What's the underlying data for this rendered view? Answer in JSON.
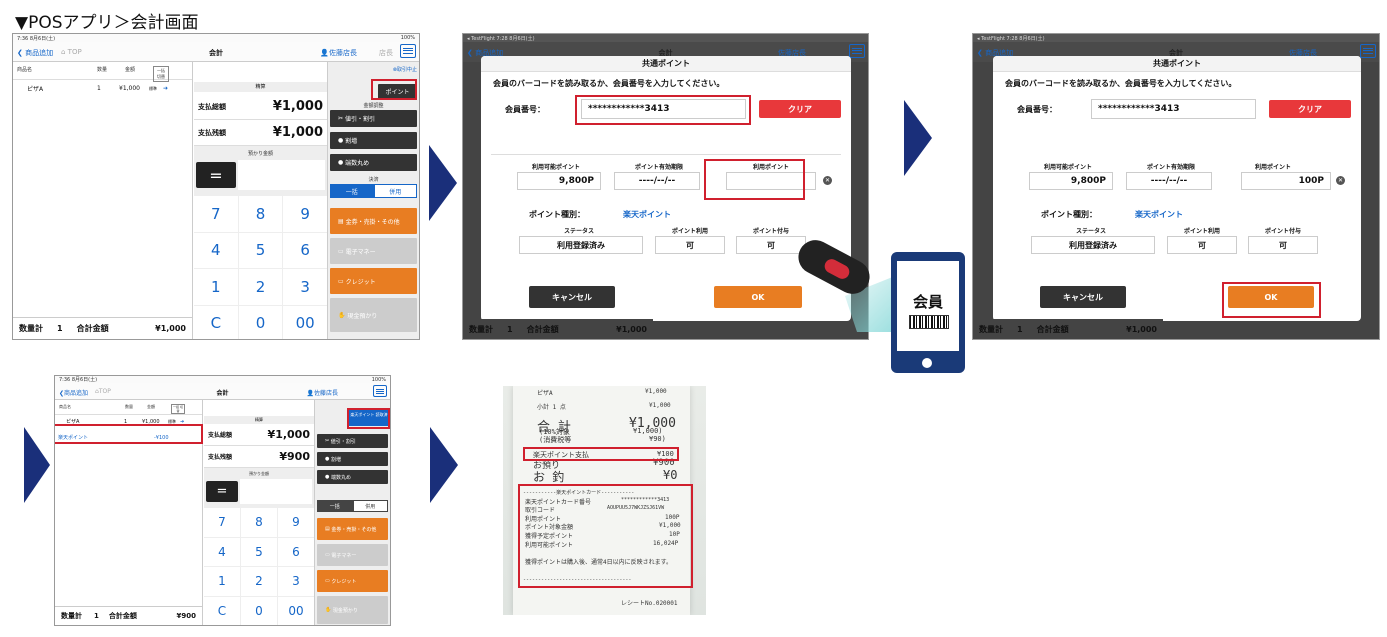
{
  "heading": "▼POSアプリ＞会計画面",
  "pos": {
    "status_time": "7:36 8月6日(土)",
    "back": "商品追加",
    "top": "TOP",
    "screen": "会計",
    "user": "佐藤店長",
    "store": "店長",
    "col_name": "商品名",
    "col_qty": "数量",
    "col_price": "金額",
    "col_batch": "一括 切替",
    "item_name": "ピザA",
    "item_qty": "1",
    "item_price": "¥1,000",
    "item_tag": "標準",
    "hold": "保留",
    "cancel_tx": "取引中止",
    "settle": "精算",
    "pay_total_label": "支払総額",
    "pay_total": "¥1,000",
    "pay_remain_label": "支払残額",
    "pay_remain": "¥1,000",
    "deposit_label": "預かり金額",
    "eq": "=",
    "keys": [
      "7",
      "8",
      "9",
      "4",
      "5",
      "6",
      "1",
      "2",
      "3",
      "C",
      "0",
      "00"
    ],
    "point_btn": "ポイント",
    "adjust": "金額調整",
    "discount": "値引・割引",
    "surcharge": "割増",
    "rounding": "端数丸め",
    "settle_type": "決済",
    "seg_single": "一括",
    "seg_split": "併用",
    "pay_cash": "金券・売掛・その他",
    "pay_emoney": "電子マネー",
    "pay_credit": "クレジット",
    "pay_deposit": "現金預かり",
    "qty_total_label": "数量計",
    "qty_total": "1",
    "grand_label": "合計金額",
    "grand": "¥1,000"
  },
  "dialog": {
    "status": "◂ TestFlight 7:28 8月6日(土)",
    "back": "商品追加",
    "top": "TOP",
    "screen": "会計",
    "user": "佐藤店長",
    "store": "店長",
    "title": "共通ポイント",
    "msg": "会員のバーコードを読み取るか、会員番号を入力してください。",
    "member_label": "会員番号：",
    "member_no": "************3413",
    "clear": "クリア",
    "avail_label": "利用可能ポイント",
    "avail": "9,800P",
    "expire_label": "ポイント有効期限",
    "expire": "----/--/--",
    "use_label": "利用ポイント",
    "use_value": "100P",
    "kind_label": "ポイント種別：",
    "kind": "楽天ポイント",
    "status_label": "ステータス",
    "status_val": "利用登録済み",
    "use_ok_label": "ポイント利用",
    "use_ok": "可",
    "grant_label": "ポイント付与",
    "grant": "可",
    "cancel": "キャンセル",
    "ok": "OK",
    "bottom_qty_label": "数量計",
    "bottom_qty": "1",
    "bottom_total_label": "合計金額",
    "bottom_total": "¥1,000"
  },
  "phone_label": "会員",
  "pos2": {
    "point_btn": "楽天ポイント 読取済",
    "line_name": "楽天ポイント",
    "line_value": "-¥100",
    "pay_total": "¥1,000",
    "pay_remain": "¥900",
    "grand": "¥900"
  },
  "receipt": {
    "l1a": "ピザA",
    "l1b": "¥1,000",
    "l2a": "小計 1 点",
    "l2b": "¥1,000",
    "l3a": "合 計",
    "l3b": "¥1,000",
    "l4a": "(10%対象",
    "l4b": "¥1,000)",
    "l5a": "(消費税等",
    "l5b": "¥90)",
    "l6a": "楽天ポイント支払",
    "l6b": "¥100",
    "l7a": "お預り",
    "l7b": "¥900",
    "l8a": "お 釣",
    "l8b": "¥0",
    "c0": "-----------楽天ポイントカード-----------",
    "c1a": "楽天ポイントカード番号",
    "c1b": "************3413",
    "c2a": "取引コード",
    "c2b": "AOUPUU5J7WKJZSJ61VW",
    "c3a": "利用ポイント",
    "c3b": "100P",
    "c4a": "ポイント対象金額",
    "c4b": "¥1,000",
    "c5a": "獲得予定ポイント",
    "c5b": "10P",
    "c6a": "利用可能ポイント",
    "c6b": "16,024P",
    "c7": "獲得ポイントは購入後、通常4日以内に反映されます。",
    "c8": "------------------------------------",
    "foot": "レシートNo.020001"
  }
}
